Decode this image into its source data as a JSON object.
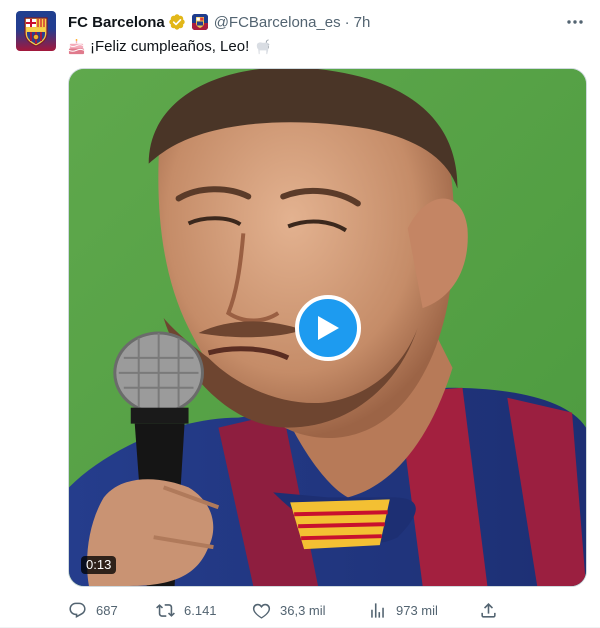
{
  "tweet": {
    "display_name": "FC Barcelona",
    "handle": "@FCBarcelona_es",
    "separator": "·",
    "time": "7h",
    "text": "¡Feliz cumpleaños, Leo!",
    "leading_emoji": "birthday-cake-icon",
    "trailing_emoji": "goat-icon",
    "verified_color": "#e2b719"
  },
  "media": {
    "type": "video",
    "duration": "0:13"
  },
  "actions": {
    "reply_count": "687",
    "retweet_count": "6.141",
    "like_count": "36,3 mil",
    "views_count": "973 mil"
  },
  "colors": {
    "accent": "#1d9bf0",
    "muted_text": "#536471"
  }
}
